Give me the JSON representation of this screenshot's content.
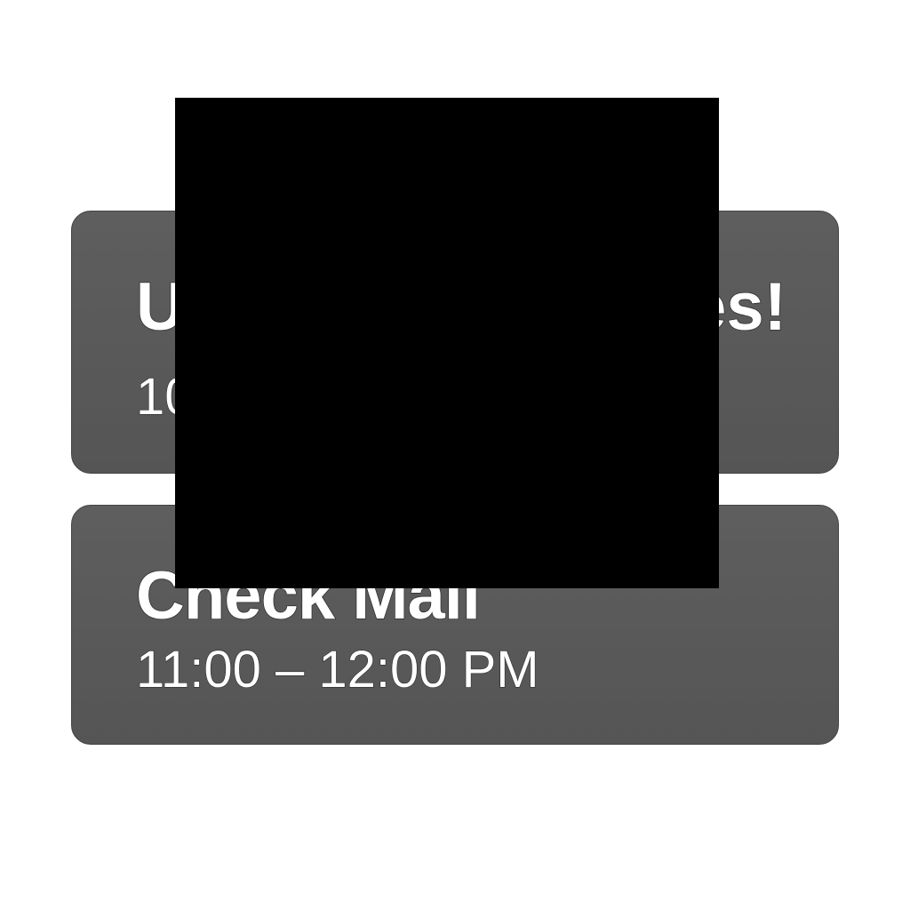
{
  "events": [
    {
      "title": "U",
      "title_tail": "es!",
      "time": "10"
    },
    {
      "title": "Check Mail",
      "time": "11:00 – 12:00 PM"
    }
  ],
  "colors": {
    "background": "#ffffff",
    "card": "#5a5a5a",
    "text": "#ffffff",
    "redaction": "#000000"
  }
}
